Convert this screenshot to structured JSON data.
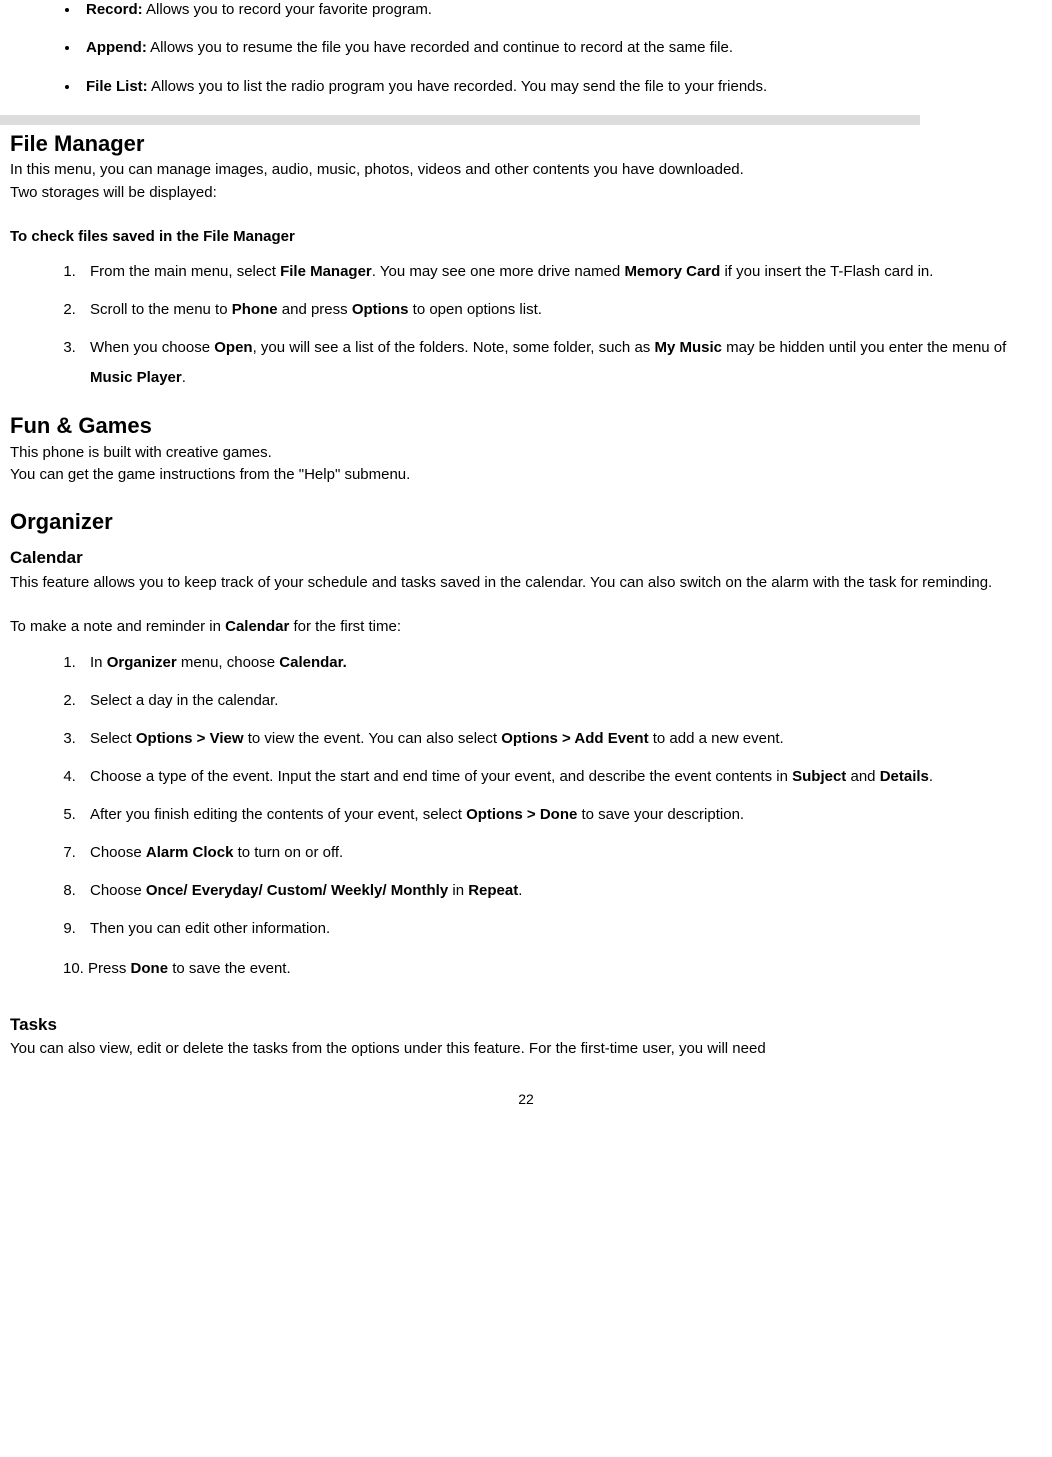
{
  "topBullets": [
    {
      "label": "Record:",
      "text": " Allows you to record your favorite program."
    },
    {
      "label": "Append:",
      "text": " Allows you to resume the file you have recorded and continue to record at the same file."
    },
    {
      "label": "File List:",
      "text": " Allows you to list the radio program you have recorded. You may send the file to your friends."
    }
  ],
  "fileManager": {
    "title": "File Manager",
    "intro1": "In this menu, you can manage images, audio, music, photos, videos and other contents you have downloaded.",
    "intro2": "Two storages will be displayed:",
    "subHeading": "To check files saved in the File Manager",
    "steps": [
      {
        "pre": "From the main menu, select ",
        "b1": "File Manager",
        "mid": ". You may see one more drive named ",
        "b2": "Memory Card",
        "post": " if you insert the T-Flash card in."
      },
      {
        "pre": "Scroll to the menu to ",
        "b1": "Phone",
        "mid": " and press ",
        "b2": "Options",
        "post": " to open options list."
      },
      {
        "pre": "When you choose ",
        "b1": "Open",
        "mid": ", you will see a list of the folders. Note, some folder, such as ",
        "b2": "My Music",
        "post1": " may be hidden until you enter the menu of ",
        "b3": "Music Player",
        "post2": "."
      }
    ]
  },
  "funGames": {
    "title": "Fun & Games",
    "line1": "This phone is built with creative games.",
    "line2": "You can get the game instructions from the \"Help\" submenu."
  },
  "organizer": {
    "title": "Organizer",
    "calendar": {
      "title": "Calendar",
      "intro": "This feature allows you to keep track of your schedule and tasks saved in the calendar. You can also switch on the alarm with the task for reminding.",
      "lead_pre": "To make a note and reminder in ",
      "lead_b": "Calendar",
      "lead_post": " for the first time:",
      "steps": {
        "s1_pre": "In ",
        "s1_b1": "Organizer",
        "s1_mid": " menu, choose ",
        "s1_b2": "Calendar.",
        "s2": "Select a day in the calendar.",
        "s3_pre": "Select ",
        "s3_b1": "Options > View",
        "s3_mid": " to view the event. You can also select ",
        "s3_b2": "Options > Add Event",
        "s3_post": " to add a new event.",
        "s4_pre": "Choose a type of the event. Input the start and end time of your event, and describe the event contents in ",
        "s4_b1": "Subject",
        "s4_mid": " and ",
        "s4_b2": "Details",
        "s4_post": ".",
        "s5_pre": "After you finish editing the contents of your event, select ",
        "s5_b1": "Options > Done",
        "s5_post": " to save your description.",
        "s7_pre": "Choose ",
        "s7_b1": "Alarm Clock",
        "s7_post": " to turn on or off.",
        "s8_pre": "Choose ",
        "s8_b1": "Once/ Everyday/ Custom/ Weekly/ Monthly",
        "s8_mid": " in ",
        "s8_b2": "Repeat",
        "s8_post": ".",
        "s9_pre": " Then you can edit other information.",
        "s10_pre": "Press ",
        "s10_b1": "Done",
        "s10_post": " to save the event.",
        "n10": "10."
      }
    },
    "tasks": {
      "title": "Tasks",
      "text": "You can also view, edit or delete the tasks from the options under this feature. For the first-time user, you will need"
    }
  },
  "pageNumber": "22"
}
